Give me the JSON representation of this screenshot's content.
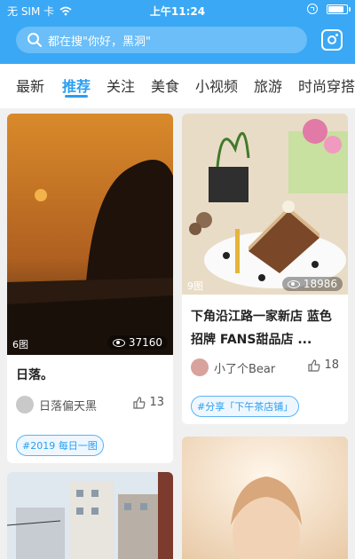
{
  "status": {
    "carrier": "无 SIM 卡",
    "time": "上午11:24",
    "battery_level": 0.9
  },
  "search": {
    "placeholder": "都在搜\"你好，黑洞\""
  },
  "tabs": [
    {
      "label": "最新"
    },
    {
      "label": "推荐"
    },
    {
      "label": "关注"
    },
    {
      "label": "美食"
    },
    {
      "label": "小视频"
    },
    {
      "label": "旅游"
    },
    {
      "label": "时尚穿搭"
    }
  ],
  "active_tab": "推荐",
  "cards": [
    {
      "photo_count": "6图",
      "views": "37160",
      "title": "日落。",
      "author": "日落偏天黑",
      "likes": "13",
      "tag": "#2019 每日一图"
    },
    {
      "photo_count": "9图",
      "views": "18986",
      "title": "下角沿江路一家新店 蓝色招牌 FANS甜品店 ...",
      "author": "小了个Bear",
      "likes": "18",
      "tag": "#分享「下午茶店铺」"
    }
  ],
  "colors": {
    "header": "#3aa8f4",
    "accent": "#2a9ef0"
  }
}
